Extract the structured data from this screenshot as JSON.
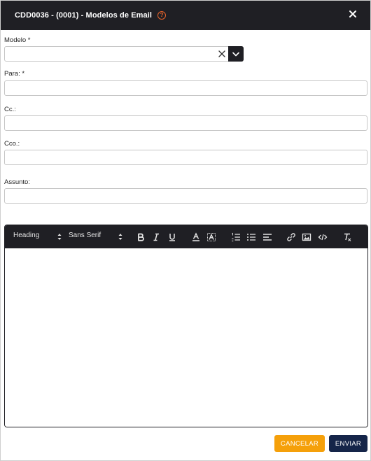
{
  "dialog": {
    "title": "CDD0036 - (0001) - Modelos de Email",
    "help_icon": "?"
  },
  "fields": {
    "modelo": {
      "label": "Modelo *",
      "value": ""
    },
    "para": {
      "label": "Para: *",
      "value": ""
    },
    "cc": {
      "label": "Cc.:",
      "value": ""
    },
    "cco": {
      "label": "Cco.:",
      "value": ""
    },
    "assunto": {
      "label": "Assunto:",
      "value": ""
    }
  },
  "editor": {
    "heading_select": "Heading",
    "font_select": "Sans Serif",
    "body": ""
  },
  "buttons": {
    "cancel": "CANCELAR",
    "send": "ENVIAR"
  },
  "colors": {
    "header_bg": "#1f1f24",
    "help_accent": "#e8632a",
    "cancel_bg": "#f5a00a",
    "send_bg": "#152549"
  }
}
